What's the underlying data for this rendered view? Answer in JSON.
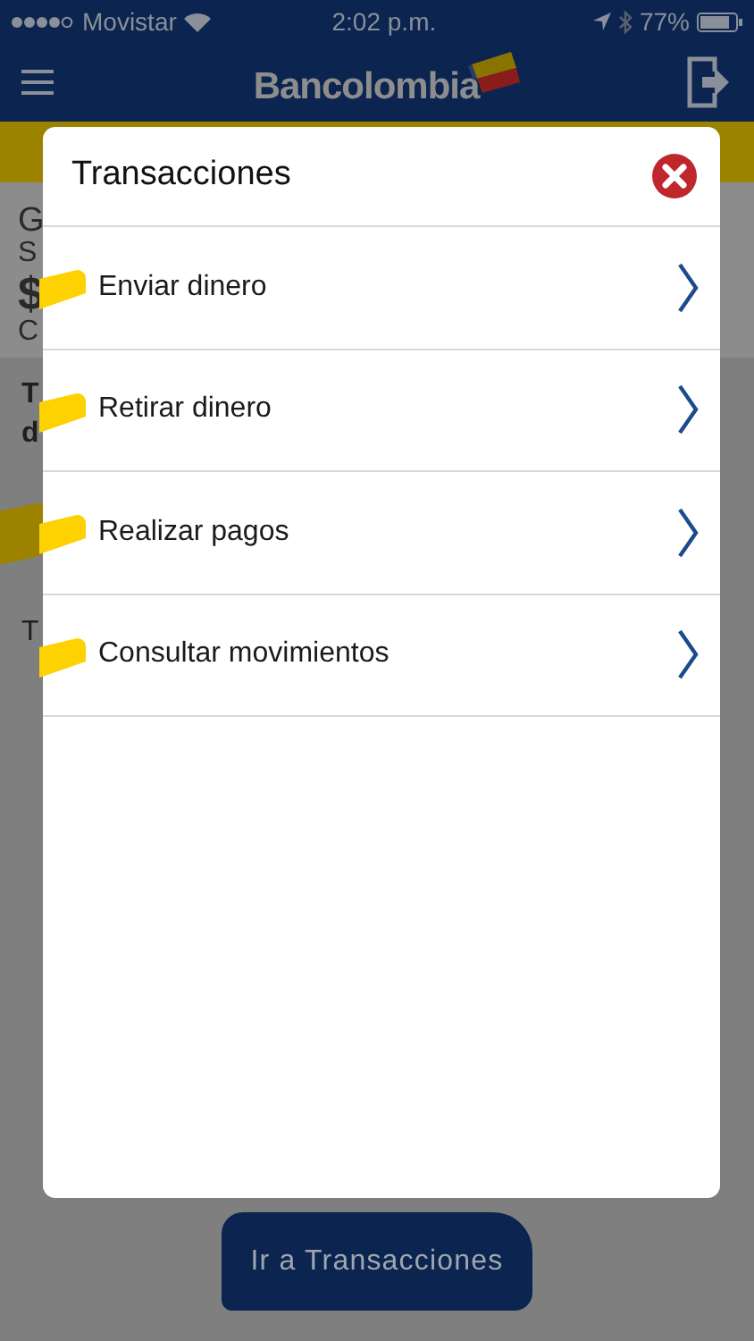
{
  "status_bar": {
    "carrier": "Movistar",
    "time": "2:02 p.m.",
    "battery": "77%"
  },
  "header": {
    "logo": "Bancolombia"
  },
  "background": {
    "account_lines": [
      "G",
      "S",
      "$",
      "C"
    ],
    "message_lines": [
      "T",
      "d"
    ],
    "second_message": "T"
  },
  "modal": {
    "title": "Transacciones",
    "items": [
      {
        "label": "Enviar dinero"
      },
      {
        "label": "Retirar dinero"
      },
      {
        "label": "Realizar pagos"
      },
      {
        "label": "Consultar movimientos"
      }
    ]
  },
  "button": {
    "label": "Ir a Transacciones"
  }
}
